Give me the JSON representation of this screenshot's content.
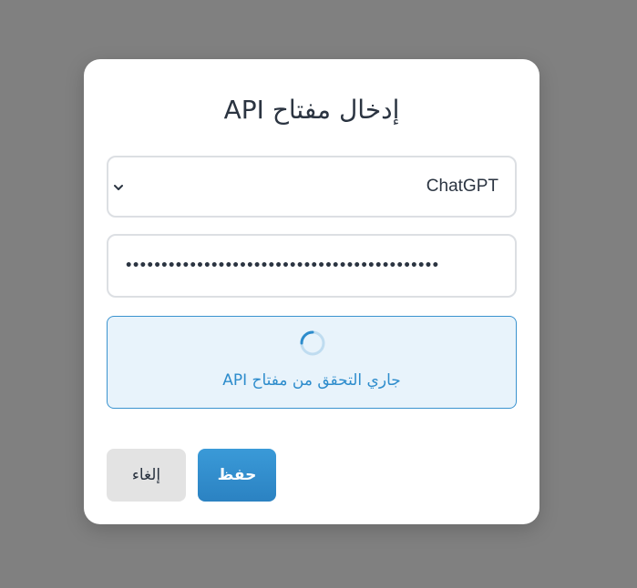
{
  "dialog": {
    "title": "إدخال مفتاح API",
    "provider_select": {
      "selected": "ChatGPT"
    },
    "api_key_field": {
      "masked_value": "••••••••••••••••••••••••••••••••••••••••••••"
    },
    "status": {
      "message": "جاري التحقق من مفتاح API",
      "color": "#2d8ccc"
    },
    "buttons": {
      "save_label": "حفظ",
      "cancel_label": "إلغاء"
    }
  },
  "colors": {
    "accent": "#2b82c2",
    "overlay": "#808080",
    "status_background": "#e8f3fb"
  },
  "icons": {
    "dropdown": "chevron-down-icon",
    "loading": "spinner-icon"
  }
}
